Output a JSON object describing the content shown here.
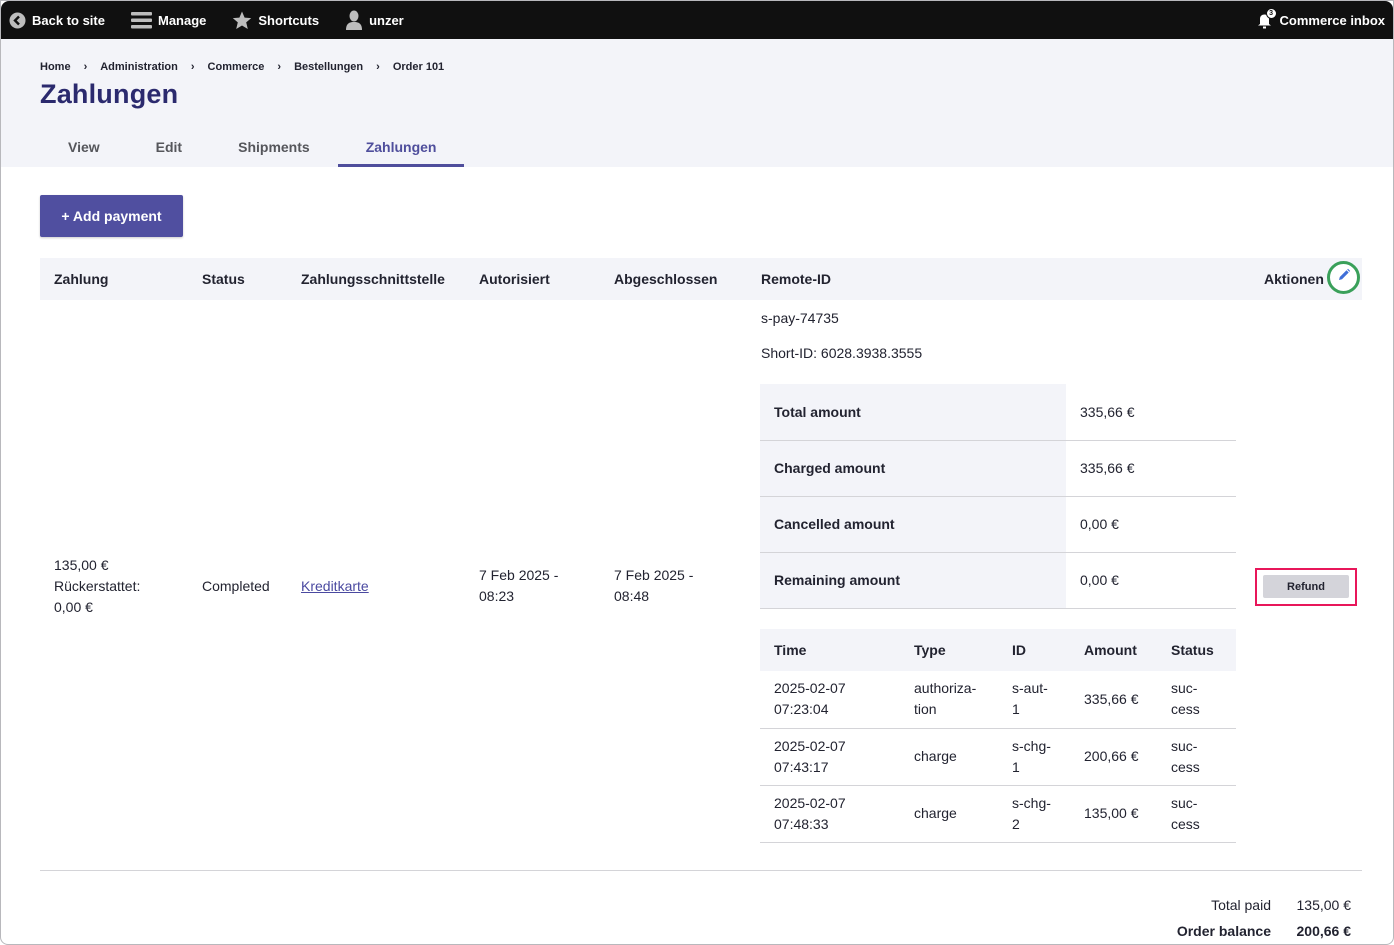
{
  "toolbar": {
    "back_to_site": "Back to site",
    "manage": "Manage",
    "shortcuts": "Shortcuts",
    "user": "unzer",
    "inbox": "Commerce inbox",
    "inbox_count": "3"
  },
  "breadcrumb": [
    "Home",
    "Administration",
    "Commerce",
    "Bestellungen",
    "Order 101"
  ],
  "page_title": "Zahlungen",
  "tabs": [
    {
      "label": "View",
      "active": false
    },
    {
      "label": "Edit",
      "active": false
    },
    {
      "label": "Shipments",
      "active": false
    },
    {
      "label": "Zahlungen",
      "active": true
    }
  ],
  "add_payment_label": "+ Add payment",
  "payments_table": {
    "headers": [
      "Zahlung",
      "Status",
      "Zahlungsschnittstelle",
      "Autorisiert",
      "Abgeschlossen",
      "Remote-ID",
      "Aktionen"
    ],
    "row": {
      "amount": "135,00 €",
      "refunded_label": "Rückerstattet:",
      "refunded_value": "0,00 €",
      "status": "Completed",
      "gateway": "Kreditkarte",
      "authorized_line1": "7 Feb 2025 -",
      "authorized_line2": "08:23",
      "completed_line1": "7 Feb 2025 -",
      "completed_line2": "08:48",
      "remote_id": "s-pay-74735",
      "short_id": "Short-ID: 6028.3938.3555",
      "refund_label": "Refund"
    }
  },
  "summary": [
    {
      "label": "Total amount",
      "value": "335,66 €"
    },
    {
      "label": "Charged amount",
      "value": "335,66 €"
    },
    {
      "label": "Cancelled amount",
      "value": "0,00 €"
    },
    {
      "label": "Remaining amount",
      "value": "0,00 €"
    }
  ],
  "transactions": {
    "headers": [
      "Time",
      "Type",
      "ID",
      "Amount",
      "Status"
    ],
    "rows": [
      {
        "time1": "2025-02-07",
        "time2": "07:23:04",
        "type1": "authoriza-",
        "type2": "tion",
        "id1": "s-aut-",
        "id2": "1",
        "amount": "335,66 €",
        "status1": "suc-",
        "status2": "cess"
      },
      {
        "time1": "2025-02-07",
        "time2": "07:43:17",
        "type1": "charge",
        "type2": "",
        "id1": "s-chg-",
        "id2": "1",
        "amount": "200,66 €",
        "status1": "suc-",
        "status2": "cess"
      },
      {
        "time1": "2025-02-07",
        "time2": "07:48:33",
        "type1": "charge",
        "type2": "",
        "id1": "s-chg-",
        "id2": "2",
        "amount": "135,00 €",
        "status1": "suc-",
        "status2": "cess"
      }
    ]
  },
  "totals": {
    "total_paid_label": "Total paid",
    "total_paid_value": "135,00 €",
    "order_balance_label": "Order balance",
    "order_balance_value": "200,66 €"
  },
  "colors": {
    "accent": "#504fa0",
    "title": "#2b2a6e",
    "highlight_outline": "#e8165a",
    "edit_ring": "#3aa05a"
  }
}
